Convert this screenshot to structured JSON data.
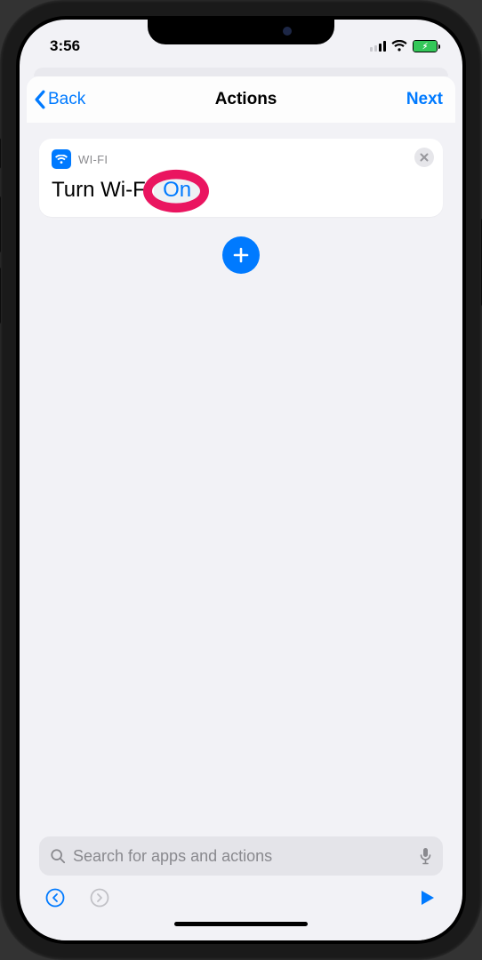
{
  "status": {
    "time": "3:56"
  },
  "nav": {
    "back_label": "Back",
    "title": "Actions",
    "next_label": "Next"
  },
  "action_card": {
    "app_label": "WI-FI",
    "action_prefix": "Turn Wi-Fi",
    "param_value": "On"
  },
  "search": {
    "placeholder": "Search for apps and actions"
  },
  "icons": {
    "wifi": "wifi-icon",
    "close": "close-icon",
    "plus": "plus-icon",
    "search": "search-icon",
    "mic": "mic-icon",
    "undo": "undo-icon",
    "redo": "redo-icon",
    "play": "play-icon",
    "chevron_left": "chevron-left-icon",
    "battery_bolt": "battery-charging-icon"
  },
  "colors": {
    "accent": "#007aff",
    "highlight": "#ea1560",
    "battery": "#34c759"
  }
}
